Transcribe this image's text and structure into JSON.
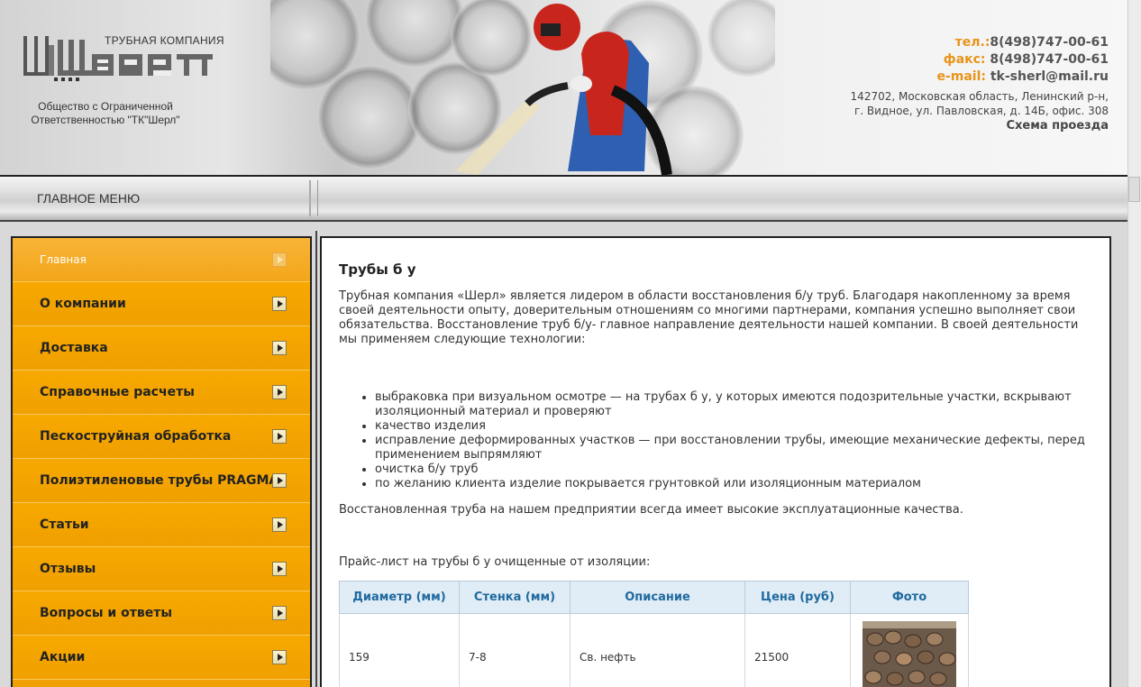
{
  "header": {
    "company_line": "ТРУБНАЯ КОМПАНИЯ",
    "logo_text": "Шерл",
    "caption_line1": "Общество с Ограниченной",
    "caption_line2": "Ответственностью \"ТК\"Шерл\"",
    "phone_label": "тел.:",
    "phone": "8(498)747-00-61",
    "fax_label": "факс: ",
    "fax": "8(498)747-00-61",
    "email_label": "e-mail: ",
    "email": "tk-sherl@mail.ru",
    "address_line1": "142702, Московская область, Ленинский р-н,",
    "address_line2": "г. Видное, ул. Павловская, д. 14Б, офис. 308",
    "route_link": "Схема проезда"
  },
  "menubar": {
    "title": "ГЛАВНОЕ МЕНЮ"
  },
  "sidebar": {
    "items": [
      {
        "label": "Главная"
      },
      {
        "label": "О компании"
      },
      {
        "label": "Доставка"
      },
      {
        "label": "Справочные расчеты"
      },
      {
        "label": "Пескоструйная обработка"
      },
      {
        "label": "Полиэтиленовые трубы PRAGMA"
      },
      {
        "label": "Статьи"
      },
      {
        "label": "Отзывы"
      },
      {
        "label": "Вопросы и ответы"
      },
      {
        "label": "Акции"
      }
    ]
  },
  "content": {
    "title": "Трубы б у",
    "intro": "Трубная компания «Шерл» является лидером в области восстановления б/у труб. Благодаря накопленному за время своей деятельности опыту, доверительным отношениям со многими партнерами, компания успешно выполняет свои обязательства. Восстановление труб б/у- главное направление деятельности нашей компании. В своей деятельности мы применяем следующие технологии:",
    "bullets": [
      "выбраковка при визуальном осмотре — на трубах б у, у которых имеются подозрительные участки, вскрывают изоляционный материал и проверяют",
      "качество изделия",
      "исправление деформированных участков — при восстановлении трубы, имеющие механические дефекты, перед применением выпрямляют",
      "очистка б/у труб",
      "по желанию клиента изделие покрывается грунтовкой или изоляционным материалом"
    ],
    "outro": "Восстановленная труба на нашем предприятии всегда имеет высокие эксплуатационные качества.",
    "price_title": "Прайс-лист на трубы б у очищенные от изоляции:",
    "table": {
      "headers": [
        "Диаметр (мм)",
        "Стенка (мм)",
        "Описание",
        "Цена (руб)",
        "Фото"
      ],
      "rows": [
        {
          "diameter": "159",
          "wall": "7-8",
          "description": "Св. нефть",
          "price": "21500"
        }
      ]
    }
  },
  "colors": {
    "sidebar_orange": "#f0a000",
    "label_orange": "#e8941a",
    "table_header_text": "#1f6a9f",
    "table_header_bg": "#e0ecf6"
  }
}
